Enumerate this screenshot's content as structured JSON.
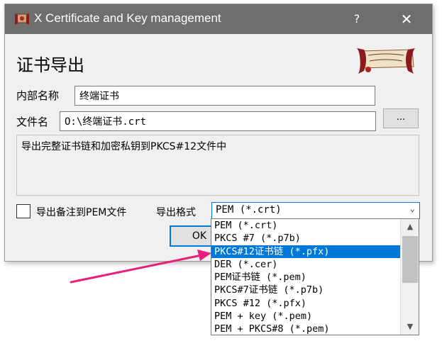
{
  "window": {
    "title": "X Certificate and Key management",
    "help": "?",
    "close": "✕"
  },
  "heading": "证书导出",
  "form": {
    "internal_name_label": "内部名称",
    "internal_name_value": "终端证书",
    "file_name_label": "文件名",
    "file_name_value": "O:\\终端证书.crt",
    "browse_label": "...",
    "description": "导出完整证书链和加密私钥到PKCS#12文件中",
    "pem_comment_label": "导出备注到PEM文件",
    "format_label": "导出格式",
    "format_selected": "PEM (*.crt)",
    "ok_label": "OK"
  },
  "dropdown": {
    "options": [
      "PEM (*.crt)",
      "PKCS #7 (*.p7b)",
      "PKCS#12证书链 (*.pfx)",
      "DER (*.cer)",
      "PEM证书链 (*.pem)",
      "PKCS#7证书链 (*.p7b)",
      "PKCS #12 (*.pfx)",
      "PEM + key (*.pem)",
      "PEM + PKCS#8 (*.pem)"
    ],
    "highlighted_index": 2
  },
  "colors": {
    "accent": "#0078d7",
    "titlebar": "#6e6e6e",
    "annotation_arrow": "#e8207a"
  }
}
